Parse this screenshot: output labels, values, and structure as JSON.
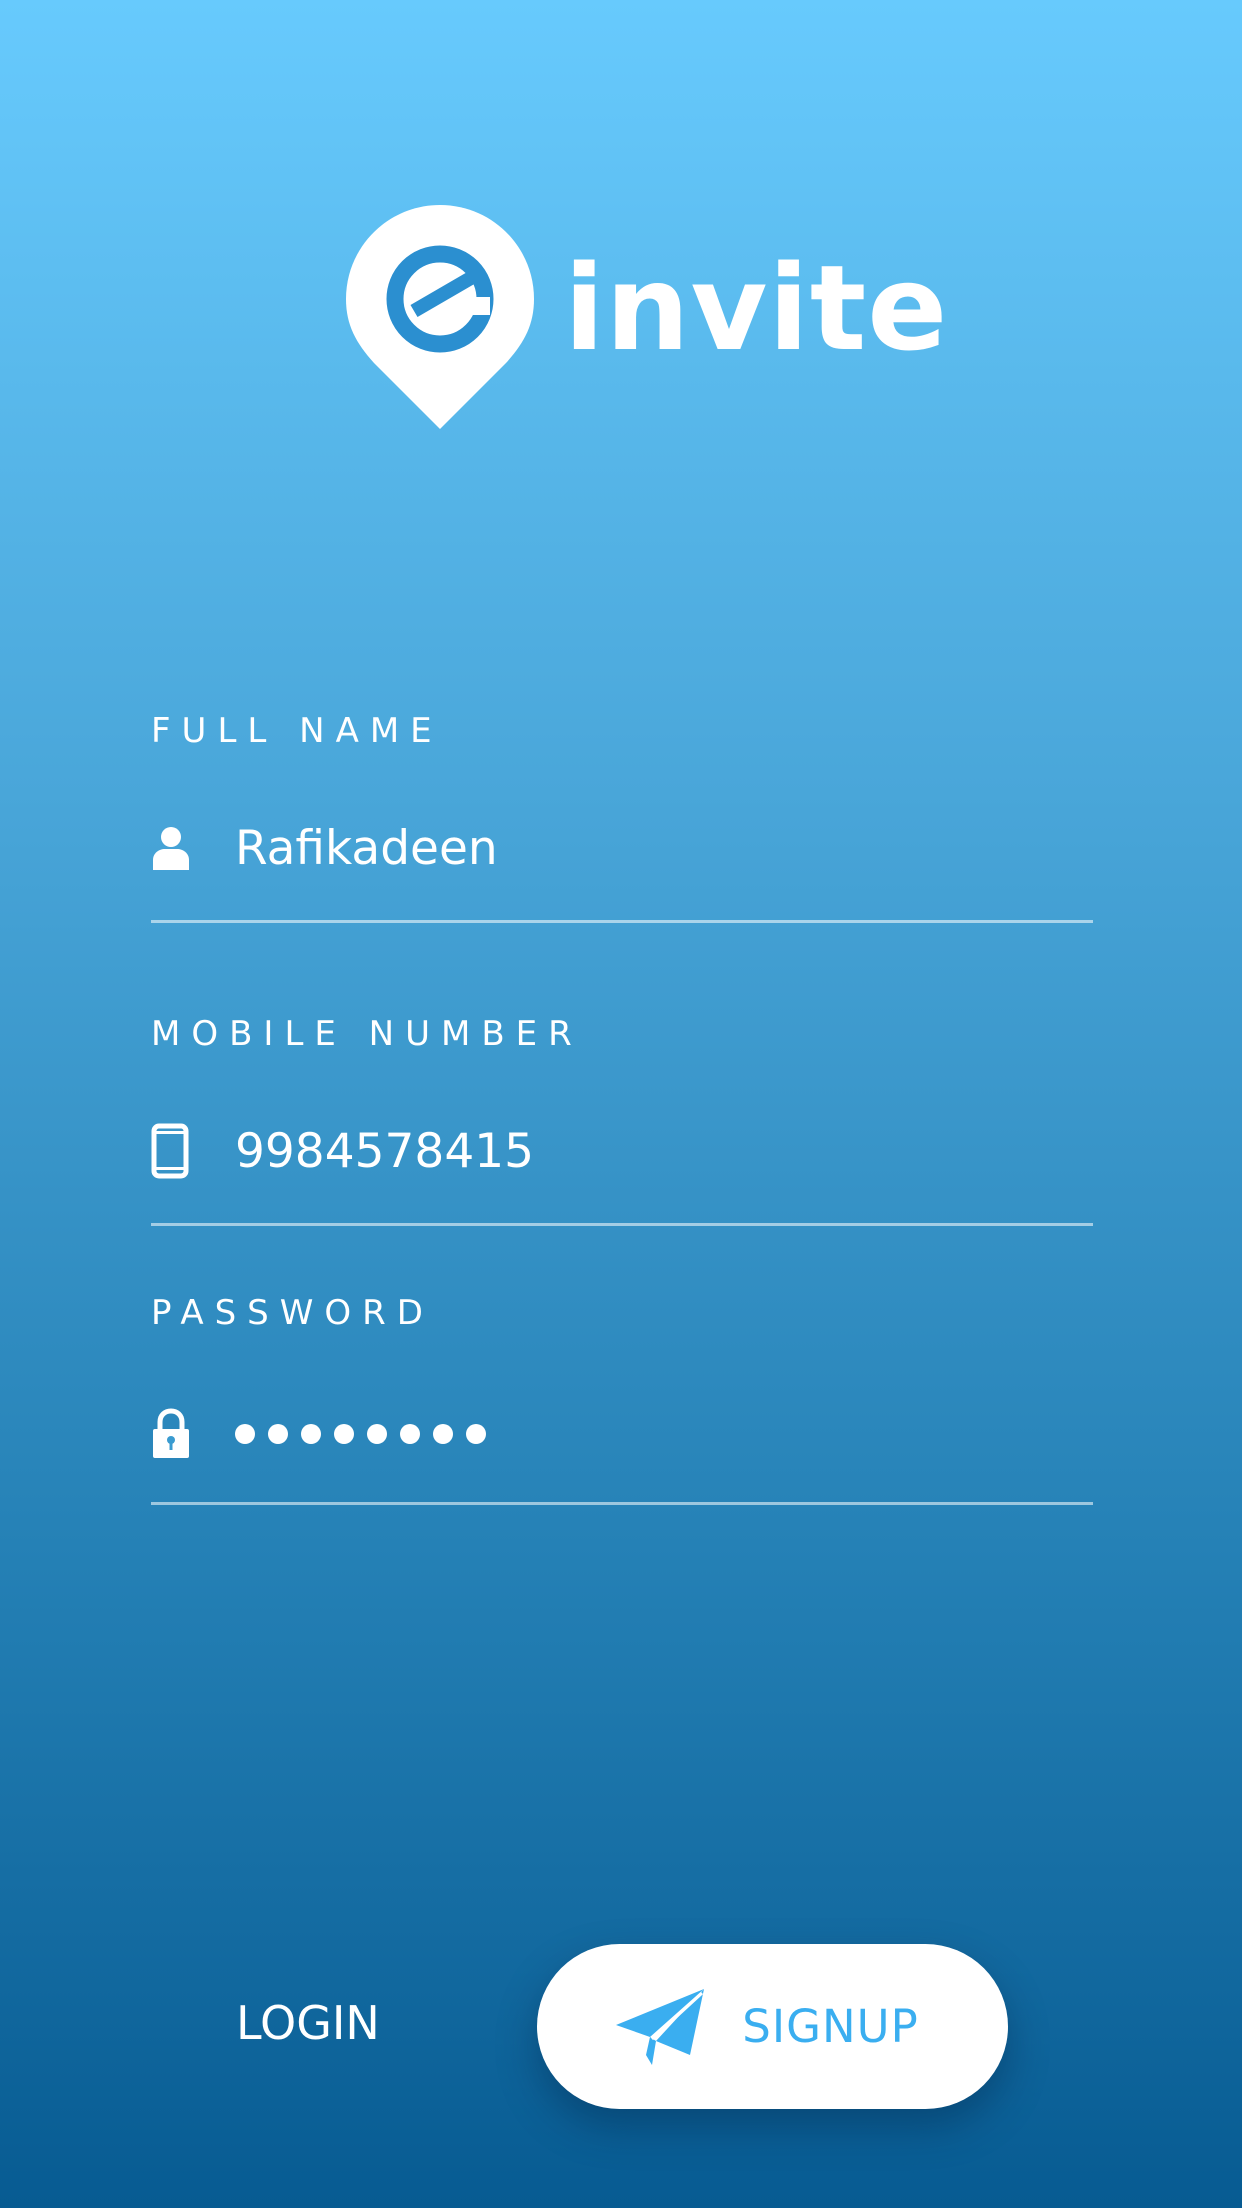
{
  "app": {
    "name": "invite",
    "logo_icon": "map-pin-e-icon"
  },
  "form": {
    "full_name": {
      "label": "FULL NAME",
      "value": "Rafikadeen",
      "icon": "user-icon"
    },
    "mobile_number": {
      "label": "MOBILE NUMBER",
      "value": "9984578415",
      "icon": "phone-icon"
    },
    "password": {
      "label": "PASSWORD",
      "masked_length": 8,
      "icon": "lock-icon"
    }
  },
  "actions": {
    "login_label": "LOGIN",
    "signup_label": "SIGNUP",
    "signup_icon": "paper-plane-icon"
  },
  "colors": {
    "gradient_top": "#67cafd",
    "gradient_bottom": "#075b92",
    "accent": "#3aaef0",
    "logo_e": "#2b8fd0",
    "text": "#ffffff"
  }
}
